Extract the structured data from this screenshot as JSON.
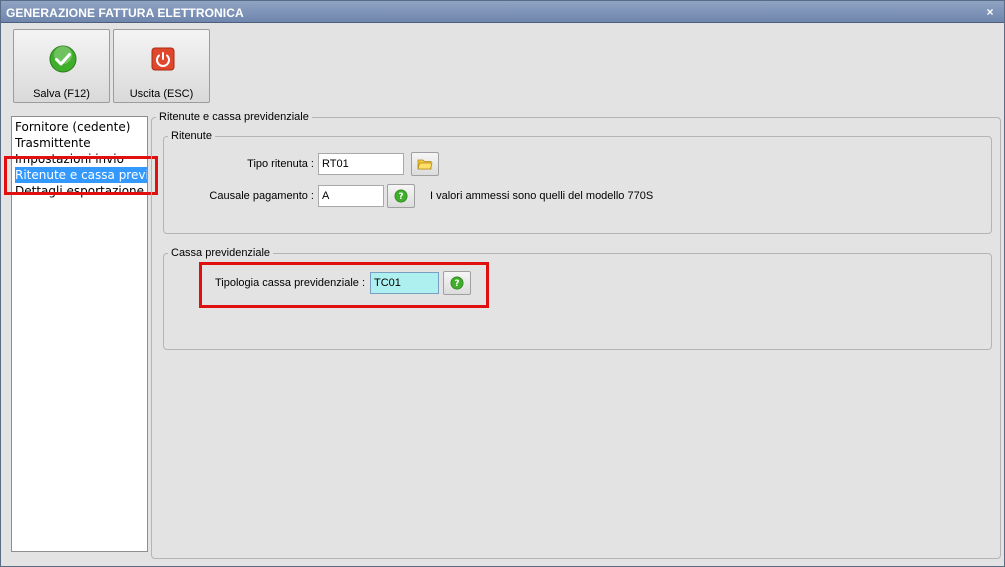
{
  "window": {
    "title": "GENERAZIONE FATTURA ELETTRONICA",
    "close_symbol": "×"
  },
  "toolbar": {
    "save_label": "Salva (F12)",
    "exit_label": "Uscita (ESC)"
  },
  "nav": {
    "items": [
      {
        "label": "Fornitore (cedente)"
      },
      {
        "label": "Trasmittente"
      },
      {
        "label": "Impostazioni invio"
      },
      {
        "label": "Ritenute e cassa previd"
      },
      {
        "label": "Dettagli esportazione"
      }
    ],
    "selected_index": 3
  },
  "main": {
    "section_title": "Ritenute e cassa previdenziale",
    "ritenute": {
      "title": "Ritenute",
      "tipo_label": "Tipo ritenuta :",
      "tipo_value": "RT01",
      "causale_label": "Causale pagamento :",
      "causale_value": "A",
      "note": "I valori ammessi sono quelli del modello 770S"
    },
    "cassa": {
      "title": "Cassa previdenziale",
      "tipologia_label": "Tipologia cassa previdenziale :",
      "tipologia_value": "TC01"
    }
  },
  "colors": {
    "selection": "#3399ff",
    "highlight_box": "#e01010",
    "focused_input": "#aef0f0",
    "check_green": "#3fae2a",
    "exit_red": "#e0462c"
  }
}
